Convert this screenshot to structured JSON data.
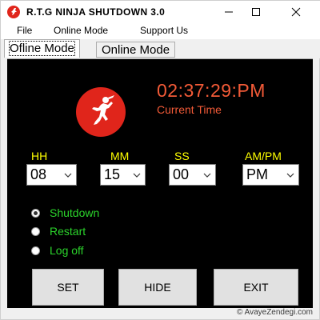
{
  "window": {
    "title": "R.T.G NINJA SHUTDOWN 3.0",
    "icon": "ninja-logo-icon",
    "controls": [
      "minimize-icon",
      "maximize-icon",
      "close-icon"
    ]
  },
  "menu": {
    "file": "File",
    "online_mode": "Online Mode",
    "support_us": "Support Us"
  },
  "tabs": [
    {
      "label": "Ofline Mode",
      "active": true
    },
    {
      "label": "Online Mode",
      "active": false
    }
  ],
  "clock": {
    "time": "02:37:29:PM",
    "label": "Current Time"
  },
  "fields": {
    "hh": {
      "label": "HH",
      "value": "08"
    },
    "mm": {
      "label": "MM",
      "value": "15"
    },
    "ss": {
      "label": "SS",
      "value": "00"
    },
    "ampm": {
      "label": "AM/PM",
      "value": "PM"
    }
  },
  "actions": [
    {
      "label": "Shutdown",
      "checked": true
    },
    {
      "label": "Restart",
      "checked": false
    },
    {
      "label": "Log off",
      "checked": false
    }
  ],
  "buttons": {
    "set": "SET",
    "hide": "HIDE",
    "exit": "EXIT"
  },
  "watermark": "© AvayeZendegi.com",
  "colors": {
    "panel_bg": "#000000",
    "brand_red": "#e0251b",
    "clock_orange": "#f25a37",
    "label_yellow": "#ffff00",
    "radio_green": "#2bd42b"
  }
}
